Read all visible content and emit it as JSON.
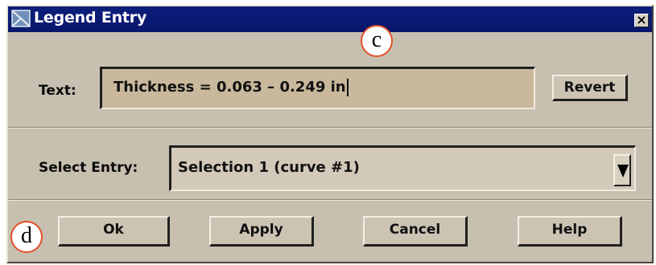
{
  "window": {
    "title": "Legend Entry",
    "close_glyph": "×",
    "title_icon": "window-app-icon"
  },
  "callouts": {
    "c": "c",
    "d": "d"
  },
  "text_row": {
    "label": "Text:",
    "value": "Thickness = 0.063 – 0.249 in",
    "revert_label": "Revert"
  },
  "select_row": {
    "label": "Select Entry:",
    "selected": "Selection 1 (curve #1)"
  },
  "buttons": {
    "ok": "Ok",
    "apply": "Apply",
    "cancel": "Cancel",
    "help": "Help"
  },
  "colors": {
    "titlebar": "#0c1f7c",
    "dialog_bg": "#c7bfb0",
    "textfield_bg": "#c9b89c",
    "callout_border": "#e2502a"
  }
}
